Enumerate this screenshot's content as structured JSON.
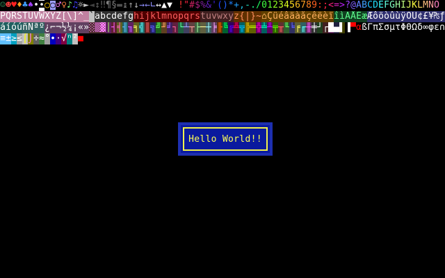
{
  "screen": {
    "background": "#000000",
    "message": "Hello World!!",
    "message_color": "#ffff55",
    "box_fill": "#0a1a9e",
    "box_border": "#f2f24a"
  },
  "charset_rows": [
    {
      "text": "☺☻♥♦♣♠•◘○◙♂♀♪♫☼►◄↕‼¶§▬↨↑↓→←∟↔▲▼ !\"#$%&'()*+,-./0123456789:;<=>?@ABCDEFGHIJKLMNO",
      "fg": [
        "#2e8b57",
        "#ff4040",
        "#ff2020",
        "#ffa020",
        "#40a0ff",
        "#a040ff",
        "#ffffff",
        "#000000",
        "#ffcc00",
        "#a0a0ff",
        "#ff80ff",
        "#ff8040",
        "#80ff80",
        "#4040ff",
        "#ffffff",
        "#c0c0c0",
        "#404040",
        "#606060",
        "#606060",
        "#808080",
        "#808080",
        "#505050",
        "#707070",
        "#a0a0a0",
        "#c0c0c0",
        "#9090ff",
        "#9090ff",
        "#9090ff",
        "#ffffff",
        "#ffffff",
        "#ffffff",
        "#ff4040",
        "#ff3030",
        "#ff2040",
        "#cc2060",
        "#aa2080",
        "#8020a0",
        "#6020c0",
        "#4020e0",
        "#2040ff",
        "#2060ff",
        "#2080ff",
        "#20a0ff",
        "#20c0e0",
        "#20e0c0",
        "#20ff90",
        "#20ff60",
        "#40ff40",
        "#60ff30",
        "#90ff20",
        "#c0ff20",
        "#e0ff20",
        "#ffe020",
        "#ffc020",
        "#ffa020",
        "#ff8020",
        "#ff6020",
        "#ff4020",
        "#ff2040",
        "#ff2080",
        "#e020c0",
        "#c020ff",
        "#a040ff",
        "#8060ff",
        "#6080ff",
        "#40a0ff",
        "#20c0ff",
        "#20e0ff",
        "#40ffff",
        "#60ffe0",
        "#80ffc0",
        "#a0ffa0",
        "#c0ff80",
        "#e0ff60",
        "#ffff40",
        "#ffe060",
        "#ffc080",
        "#ffa0a0",
        "#ff80c0",
        "#ff60e0"
      ],
      "bg": [
        "#000000",
        "#000000",
        "#000000",
        "#000000",
        "#000000",
        "#000000",
        "#000000",
        "#ffffff",
        "#000000",
        "#000000",
        "#000000",
        "#000000",
        "#000000",
        "#000000",
        "#000000",
        "#000000",
        "#000000",
        "#000000",
        "#000000",
        "#000000",
        "#000000",
        "#000000",
        "#000000",
        "#000000",
        "#000000",
        "#000000",
        "#000000",
        "#000000",
        "#000000",
        "#000000",
        "#000000",
        "#000000",
        "#000000",
        "#000000",
        "#000000",
        "#000000",
        "#000000",
        "#000000",
        "#000000",
        "#000000",
        "#000000",
        "#000000",
        "#000000",
        "#000000",
        "#000000",
        "#000000",
        "#000000",
        "#000000",
        "#000000",
        "#000000",
        "#000000",
        "#000000",
        "#000000",
        "#000000",
        "#000000",
        "#000000",
        "#000000",
        "#000000",
        "#000000",
        "#000000",
        "#000000",
        "#000000",
        "#000000",
        "#000000",
        "#000000",
        "#000000",
        "#000000",
        "#000000",
        "#000000",
        "#000000",
        "#000000",
        "#000000",
        "#000000",
        "#000000",
        "#000000",
        "#000000",
        "#000000",
        "#000000",
        "#000000",
        "#000000"
      ]
    },
    {
      "text": "PQRSTUVWXYZ[\\]^_`abcdefghijklmnopqrstuvwxyz{|}~⌂ÇüéâäàåçêëèïîìÄÅÉæÆôöòûùÿÖÜ¢£¥₧ƒ",
      "fg": [
        "#ffffff",
        "#ffffff",
        "#ffffff",
        "#ffffff",
        "#ffffff",
        "#ffffff",
        "#ffffff",
        "#ffffff",
        "#ffffff",
        "#ffffff",
        "#ffffff",
        "#ffffff",
        "#ffffff",
        "#ffffff",
        "#ffffff",
        "#ffffff",
        "#000000",
        "#ffffff",
        "#ffffff",
        "#ffffff",
        "#ffffff",
        "#ffffff",
        "#ffffff",
        "#ffffff",
        "#ff6060",
        "#ff6060",
        "#ff6060",
        "#ff6060",
        "#ff6060",
        "#ff6060",
        "#ff6060",
        "#ff6060",
        "#ff6060",
        "#ff6060",
        "#ff6060",
        "#ff6060",
        "#c08080",
        "#c08080",
        "#c08080",
        "#c08080",
        "#c08080",
        "#c08080",
        "#ff9060",
        "#ff9060",
        "#ff9060",
        "#ff9060",
        "#ff9060",
        "#ffb060",
        "#ffb060",
        "#ffb060",
        "#ffb060",
        "#ffb060",
        "#ffb060",
        "#ffb060",
        "#ffb060",
        "#ffb060",
        "#ffb060",
        "#ffb060",
        "#ffb060",
        "#ffb060",
        "#60ff90",
        "#60ff90",
        "#60ff90",
        "#60ff90",
        "#60ff90",
        "#60ff90",
        "#ffffff",
        "#ffffff",
        "#ffffff",
        "#ffffff",
        "#ffffff",
        "#ffffff",
        "#ffffff",
        "#ffffff",
        "#ffffff",
        "#ffffff",
        "#ffffff",
        "#ffffff",
        "#ffffff",
        "#ffffff"
      ],
      "bg": [
        "#c080a0",
        "#c080a0",
        "#c080a0",
        "#c080a0",
        "#c080a0",
        "#c080a0",
        "#c080a0",
        "#c080a0",
        "#c080a0",
        "#c080a0",
        "#c080a0",
        "#c080a0",
        "#c080a0",
        "#c080a0",
        "#c080a0",
        "#c080a0",
        "#c0c0c0",
        "#303030",
        "#303030",
        "#303030",
        "#303030",
        "#303030",
        "#303030",
        "#303030",
        "#500000",
        "#500000",
        "#500000",
        "#500000",
        "#500000",
        "#500000",
        "#500000",
        "#500000",
        "#500000",
        "#500000",
        "#500000",
        "#500000",
        "#402020",
        "#402020",
        "#402020",
        "#402020",
        "#402020",
        "#402020",
        "#603000",
        "#603000",
        "#603000",
        "#603000",
        "#603000",
        "#604000",
        "#604000",
        "#604000",
        "#604000",
        "#604000",
        "#604000",
        "#604000",
        "#604000",
        "#604000",
        "#604000",
        "#604000",
        "#604000",
        "#604000",
        "#104020",
        "#104020",
        "#104020",
        "#104020",
        "#104020",
        "#104020",
        "#303070",
        "#303070",
        "#303070",
        "#303070",
        "#303070",
        "#303070",
        "#303070",
        "#303070",
        "#303070",
        "#303070",
        "#303070",
        "#303070",
        "#303070",
        "#303070"
      ]
    },
    {
      "text": "áíóúñÑªº¿⌐¬½¼¡«»░▒▓│┤╡╢╖╕╣║╗╝╜╛┐└┴┬├─┼╞╟╚╔╩╦╠═╬╧╨╤╥╙╘╒╓╫╪┘┌█▄▌▐▀αßΓπΣσµτΦΘΩδ∞φε∩",
      "fg": [
        "#ffffff",
        "#ffffff",
        "#ffffff",
        "#ffffff",
        "#ffffff",
        "#ffffff",
        "#ffffff",
        "#ffffff",
        "#ffffff",
        "#ffffff",
        "#ffffff",
        "#ffffff",
        "#ffffff",
        "#ffffff",
        "#ffffff",
        "#ffffff",
        "#ff80ff",
        "#ff80ff",
        "#ff80ff",
        "#a0ff60",
        "#ff60ff",
        "#ff60c0",
        "#60c0ff",
        "#c060ff",
        "#ffff60",
        "#60ffff",
        "#ff6060",
        "#6060ff",
        "#60ff60",
        "#ffa060",
        "#a060ff",
        "#ff60a0",
        "#60ffa0",
        "#a0a0ff",
        "#ffa0a0",
        "#a0ffa0",
        "#ffffa0",
        "#a0ffff",
        "#ffa0ff",
        "#ff6000",
        "#00ff60",
        "#6000ff",
        "#ff0060",
        "#00c0ff",
        "#ffc000",
        "#c0ff00",
        "#ff00c0",
        "#00ffc0",
        "#c000ff",
        "#60ff00",
        "#ff6060",
        "#60ff60",
        "#6060ff",
        "#ffff60",
        "#60ffff",
        "#ff60ff",
        "#ffffff",
        "#ffffff",
        "#ffffff",
        "#ffffff",
        "#ffffff",
        "#ffffff",
        "#ffffff",
        "#ff0000",
        "#ff0000",
        "#ffffff",
        "#ffffff",
        "#ffffff",
        "#ffffff",
        "#ffffff",
        "#ffffff",
        "#ffffff",
        "#ffffff",
        "#ffffff",
        "#ffffff",
        "#ffffff",
        "#ffffff",
        "#ffffff",
        "#ffffff",
        "#ffffff"
      ],
      "bg": [
        "#206060",
        "#206060",
        "#206060",
        "#206060",
        "#306060",
        "#306060",
        "#306060",
        "#306060",
        "#604060",
        "#604060",
        "#604060",
        "#604060",
        "#604060",
        "#604060",
        "#604060",
        "#604060",
        "#503030",
        "#503030",
        "#503030",
        "#602060",
        "#602030",
        "#606020",
        "#206060",
        "#602060",
        "#606020",
        "#206060",
        "#602020",
        "#202060",
        "#206020",
        "#604020",
        "#402060",
        "#602040",
        "#206040",
        "#404060",
        "#604040",
        "#406040",
        "#606040",
        "#406060",
        "#604060",
        "#603000",
        "#006030",
        "#300060",
        "#600030",
        "#006060",
        "#606000",
        "#606000",
        "#600060",
        "#006060",
        "#600060",
        "#306000",
        "#603030",
        "#306030",
        "#303060",
        "#606030",
        "#306060",
        "#603060",
        "#303030",
        "#204020",
        "#402020",
        "#400040",
        "#202040",
        "#404000",
        "#000000",
        "#000000",
        "#000000",
        "#000000",
        "#000000",
        "#000000",
        "#000000",
        "#000000",
        "#000000",
        "#000000",
        "#000000",
        "#000000",
        "#000000",
        "#000000",
        "#000000",
        "#000000",
        "#000000",
        "#000000"
      ]
    },
    {
      "text": "≡±≥≤⌠⌡÷≈°∙·√ⁿ²■ ",
      "fg": [
        "#ffffff",
        "#ffffff",
        "#ffffff",
        "#ffffff",
        "#ffff00",
        "#ff80ff",
        "#ffffff",
        "#ffffff",
        "#ffffff",
        "#ffffff",
        "#ffffff",
        "#ffffff",
        "#ffffff",
        "#ffffff",
        "#ff0000",
        "#000000"
      ],
      "bg": [
        "#60c0ff",
        "#60c0ff",
        "#00a0c0",
        "#a0a0a0",
        "#c0c0c0",
        "#808000",
        "#606060",
        "#408040",
        "#a0a0a0",
        "#0000c0",
        "#400080",
        "#800040",
        "#008080",
        "#c0c0c0",
        "#000000",
        "#000000"
      ]
    }
  ]
}
